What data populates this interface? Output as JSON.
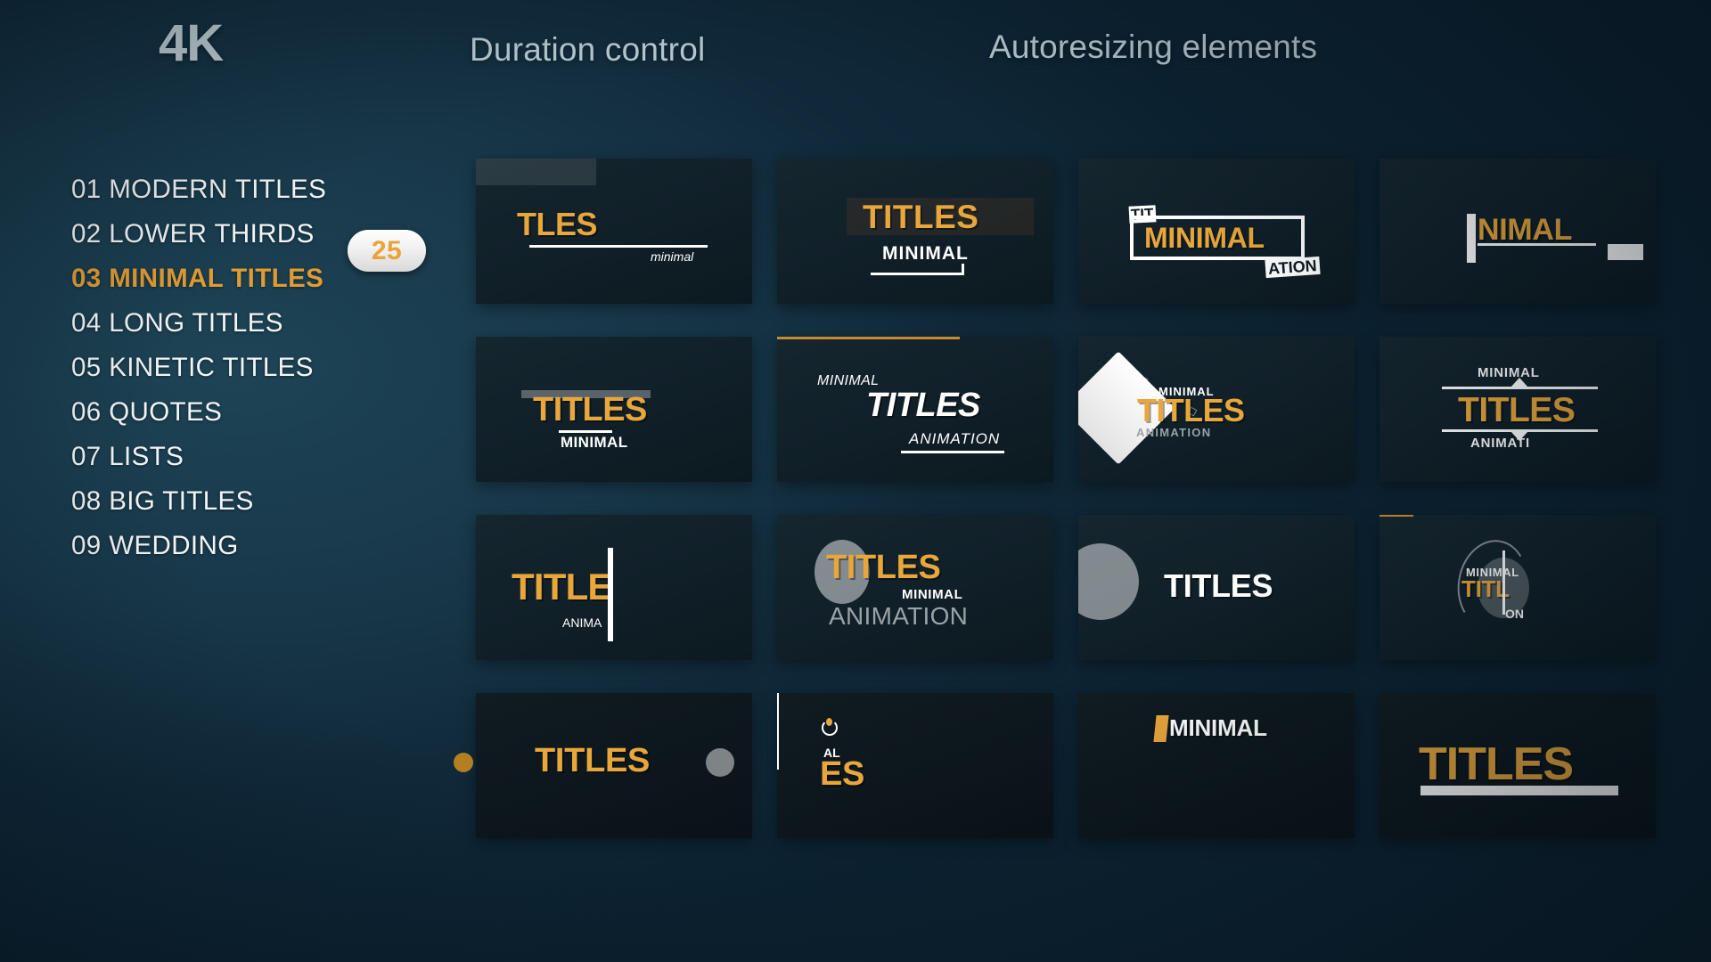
{
  "headers": {
    "resolution": "4K",
    "duration_control": "Duration control",
    "autoresizing": "Autoresizing elements"
  },
  "badge": {
    "count": "25"
  },
  "colors": {
    "background_top": "#1b4356",
    "background_bottom": "#0b1f2e",
    "accent_gold": "#e8a63b",
    "active_item": "#e09b33",
    "text_primary": "#f2f6f8",
    "header_text": "#b9cbd3",
    "tile_bg": "#101f28"
  },
  "sidebar": {
    "items": [
      {
        "label": "01 MODERN TITLES",
        "active": false
      },
      {
        "label": "02 LOWER THIRDS",
        "active": false
      },
      {
        "label": "03 MINIMAL TITLES",
        "active": true
      },
      {
        "label": "04 LONG TITLES",
        "active": false
      },
      {
        "label": "05 KINETIC TITLES",
        "active": false
      },
      {
        "label": "06 QUOTES",
        "active": false
      },
      {
        "label": "07 LISTS",
        "active": false
      },
      {
        "label": "08 BIG TITLES",
        "active": false
      },
      {
        "label": "09 WEDDING",
        "active": false
      }
    ]
  },
  "tiles": [
    {
      "id": 1,
      "title": "TLES",
      "sub": "minimal"
    },
    {
      "id": 2,
      "title": "TITLES",
      "sub": "MINIMAL"
    },
    {
      "id": 3,
      "title": "MINIMAL",
      "sub": "TIT",
      "sub2": "ATION"
    },
    {
      "id": 4,
      "title": "NIMAL",
      "sub": ""
    },
    {
      "id": 5,
      "title": "TITLES",
      "sub": "MINIMAL"
    },
    {
      "id": 6,
      "title": "TITLES",
      "sub": "MINIMAL",
      "sub2": "ANIMATION"
    },
    {
      "id": 7,
      "title": "TITLES",
      "sub": "MINIMAL",
      "sub2": "ANIMATION"
    },
    {
      "id": 8,
      "title": "TITLES",
      "sub": "MINIMAL",
      "sub2": "ANIMATI"
    },
    {
      "id": 9,
      "title": "TITLE",
      "sub": "ANIMA"
    },
    {
      "id": 10,
      "title": "TITLES",
      "sub": "MINIMAL",
      "sub2": "ANIMATION"
    },
    {
      "id": 11,
      "title": "TITLES",
      "sub": ""
    },
    {
      "id": 12,
      "title": "TITL",
      "sub": "MINIMAL",
      "sub2": "ON"
    },
    {
      "id": 13,
      "title": "TITLES",
      "sub": ""
    },
    {
      "id": 14,
      "title": "ES",
      "sub": "AL"
    },
    {
      "id": 15,
      "title": "MINIMAL",
      "sub": ""
    },
    {
      "id": 16,
      "title": "TITLES",
      "sub": ""
    }
  ]
}
